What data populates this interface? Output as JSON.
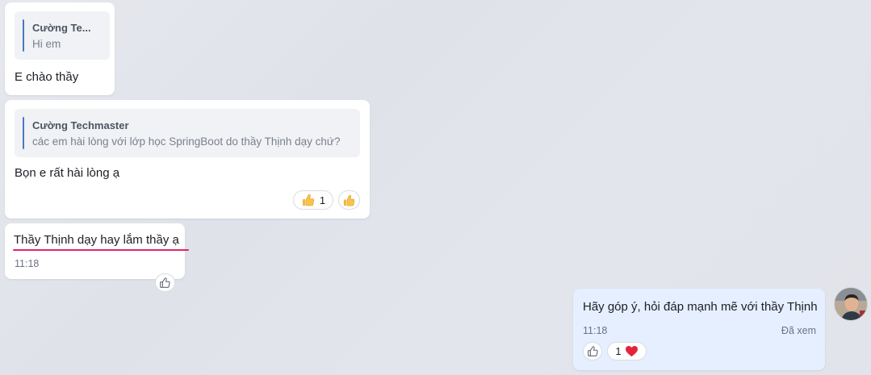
{
  "messages": [
    {
      "quote_author": "Cường Te...",
      "quote_text": "Hi em",
      "text": "E chào thầy"
    },
    {
      "quote_author": "Cường Techmaster",
      "quote_text": "các em hài lòng với lớp học SpringBoot do thầy Thịnh dạy chứ?",
      "text": "Bọn e rất hài lòng ạ",
      "reaction_count": "1",
      "reaction_emoji_icon": "thumbs-up-emoji",
      "add_reaction_icon": "thumbs-up-emoji"
    },
    {
      "text": "Thầy Thịnh dạy hay lắm thầy ạ",
      "time": "11:18",
      "underline_color": "#e0246b",
      "add_reaction_icon": "thumbs-up-outline-icon"
    },
    {
      "text": "Hãy góp ý, hỏi đáp mạnh mẽ với thầy Thịnh",
      "time": "11:18",
      "status": "Đã xem",
      "bubble_color": "#e5efff",
      "add_reaction_icon": "thumbs-up-outline-icon",
      "reaction_count": "1",
      "reaction_emoji_icon": "heart-emoji",
      "avatar_icon": "user-avatar"
    }
  ]
}
